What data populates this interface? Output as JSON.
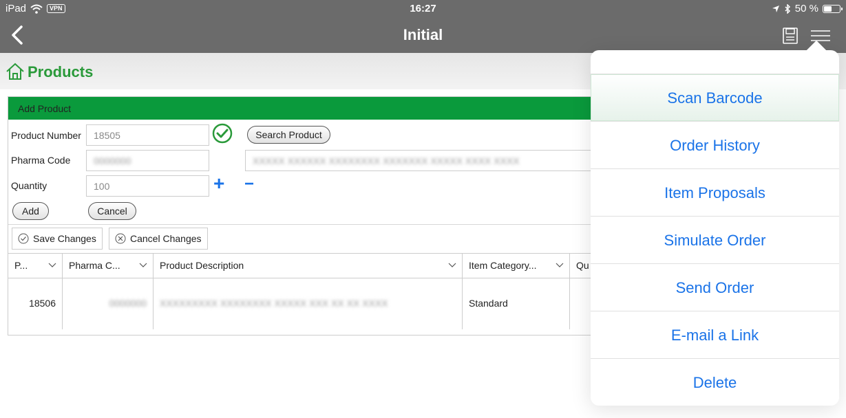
{
  "status": {
    "device": "iPad",
    "vpn": "VPN",
    "time": "16:27",
    "battery": "50 %",
    "battery_level": 0.5
  },
  "nav": {
    "title": "Initial"
  },
  "page": {
    "title": "Products"
  },
  "form": {
    "section_title": "Add Product",
    "product_number_label": "Product Number",
    "product_number_value": "18505",
    "pharma_code_label": "Pharma Code",
    "pharma_code_value": "0000000",
    "pharma_desc_value": "XXXXX XXXXXX XXXXXXXX XXXXXXX XXXXX XXXX XXXX",
    "quantity_label": "Quantity",
    "quantity_value": "100",
    "search_button": "Search Product",
    "add_button": "Add",
    "cancel_button": "Cancel",
    "plus_symbol": "+",
    "minus_symbol": "−"
  },
  "toolbar": {
    "save_changes": "Save Changes",
    "cancel_changes": "Cancel Changes"
  },
  "table": {
    "columns": [
      "P...",
      "Pharma C...",
      "Product Description",
      "Item Category...",
      "Qu"
    ],
    "rows": [
      {
        "product": "18506",
        "pharma": "0000000",
        "description": "XXXXXXXXX XXXXXXXX XXXXX XXX XX XX XXXX",
        "category": "Standard"
      }
    ]
  },
  "menu": {
    "items": [
      "Scan Barcode",
      "Order History",
      "Item Proposals",
      "Simulate Order",
      "Send Order",
      "E-mail a Link",
      "Delete"
    ]
  },
  "colors": {
    "accent": "#1a73e8",
    "brand_green": "#0a9a3c",
    "nav_gray": "#6b6b6b"
  }
}
